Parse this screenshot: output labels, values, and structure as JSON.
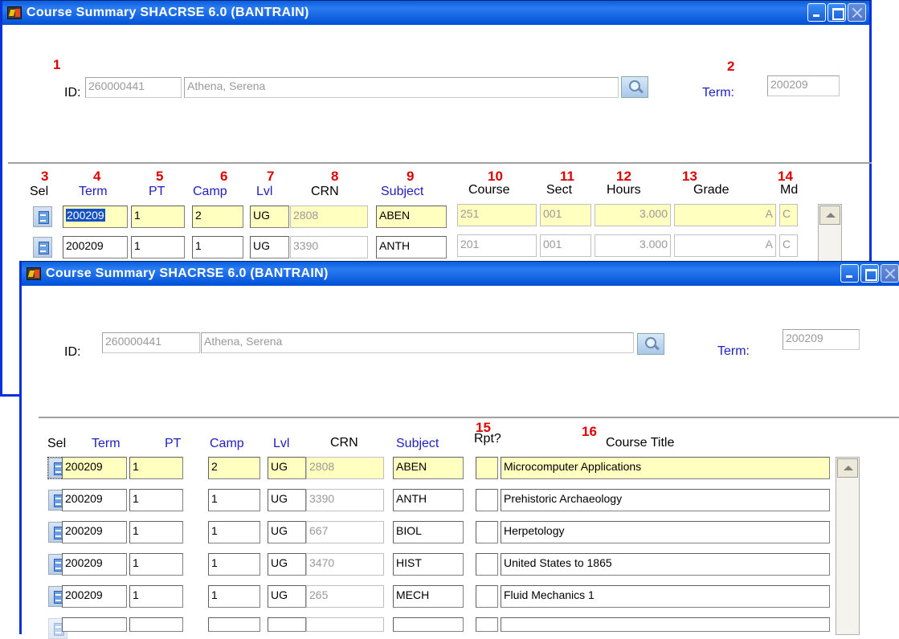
{
  "back_window": {
    "title": "Course Summary  SHACRSE  6.0  (BANTRAIN)",
    "id_label": "ID:",
    "id_value": "260000441",
    "name_value": "Athena, Serena",
    "term_label": "Term:",
    "term_value": "200209",
    "annotations": [
      "1",
      "2",
      "3",
      "4",
      "5",
      "6",
      "7",
      "8",
      "9",
      "10",
      "11",
      "12",
      "13",
      "14"
    ],
    "columns": [
      "Sel",
      "Term",
      "PT",
      "Camp",
      "Lvl",
      "CRN",
      "Subject",
      "Course",
      "Sect",
      "Hours",
      "Grade",
      "Md"
    ],
    "rows": [
      {
        "term": "200209",
        "pt": "1",
        "camp": "2",
        "lvl": "UG",
        "crn": "2808",
        "subject": "ABEN",
        "course": "251",
        "sect": "001",
        "hours": "3.000",
        "grade": "A",
        "md": "C"
      },
      {
        "term": "200209",
        "pt": "1",
        "camp": "1",
        "lvl": "UG",
        "crn": "3390",
        "subject": "ANTH",
        "course": "201",
        "sect": "001",
        "hours": "3.000",
        "grade": "A",
        "md": "C"
      }
    ]
  },
  "front_window": {
    "title": "Course Summary  SHACRSE  6.0  (BANTRAIN)",
    "id_label": "ID:",
    "id_value": "260000441",
    "name_value": "Athena, Serena",
    "term_label": "Term:",
    "term_value": "200209",
    "annotations": [
      "15",
      "16"
    ],
    "columns": [
      "Sel",
      "Term",
      "PT",
      "Camp",
      "Lvl",
      "CRN",
      "Subject",
      "Rpt?",
      "Course Title"
    ],
    "rows": [
      {
        "term": "200209",
        "pt": "1",
        "camp": "2",
        "lvl": "UG",
        "crn": "2808",
        "subject": "ABEN",
        "rpt": "",
        "title": "Microcomputer Applications"
      },
      {
        "term": "200209",
        "pt": "1",
        "camp": "1",
        "lvl": "UG",
        "crn": "3390",
        "subject": "ANTH",
        "rpt": "",
        "title": "Prehistoric Archaeology"
      },
      {
        "term": "200209",
        "pt": "1",
        "camp": "1",
        "lvl": "UG",
        "crn": "667",
        "subject": "BIOL",
        "rpt": "",
        "title": "Herpetology"
      },
      {
        "term": "200209",
        "pt": "1",
        "camp": "1",
        "lvl": "UG",
        "crn": "3470",
        "subject": "HIST",
        "rpt": "",
        "title": "United States to 1865"
      },
      {
        "term": "200209",
        "pt": "1",
        "camp": "1",
        "lvl": "UG",
        "crn": "265",
        "subject": "MECH",
        "rpt": "",
        "title": "Fluid Mechanics 1"
      }
    ]
  },
  "colors": {
    "titlebar": "#0054e3",
    "annotation": "#e00000",
    "label_blue": "#2020c0",
    "required_field": "#ffffc0"
  }
}
